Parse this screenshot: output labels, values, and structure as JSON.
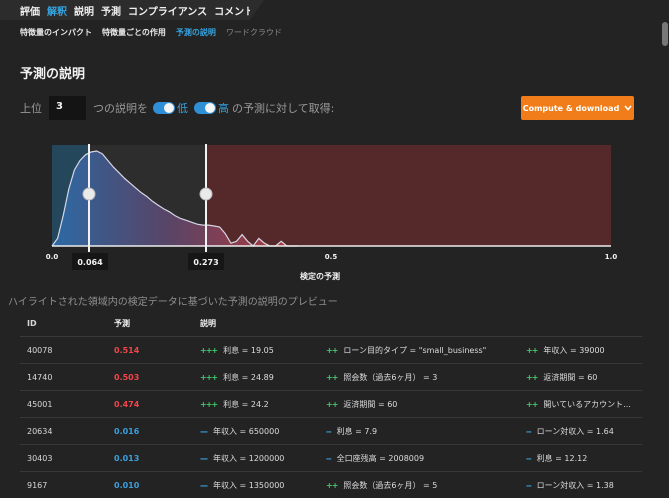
{
  "top_tabs": [
    "評価",
    "解釈",
    "説明",
    "予測",
    "コンプライアンス",
    "コメント"
  ],
  "sub_tabs": [
    "特徴量のインパクト",
    "特徴量ごとの作用",
    "予測の説明",
    "ワードクラウド"
  ],
  "section_title": "予測の説明",
  "controls": {
    "prefix": "上位",
    "count": "3",
    "explanations_label": "つの説明を",
    "low_label": "低",
    "high_label": "高",
    "suffix": "の予測に対して取得:"
  },
  "compute_button": "Compute & download",
  "colors": {
    "accent_orange": "#f07d1a",
    "positive": "#43c96b",
    "negative": "#3a9fdc",
    "high_prediction": "#f0454b"
  },
  "chart_data": {
    "type": "area",
    "xlabel": "検定の予測",
    "xlim": [
      0,
      1
    ],
    "x_ticks": [
      "0.0",
      "0.5",
      "1.0"
    ],
    "x": [
      0.0,
      0.01,
      0.02,
      0.03,
      0.04,
      0.05,
      0.06,
      0.07,
      0.08,
      0.09,
      0.1,
      0.11,
      0.12,
      0.13,
      0.14,
      0.15,
      0.16,
      0.17,
      0.18,
      0.19,
      0.2,
      0.21,
      0.22,
      0.23,
      0.24,
      0.25,
      0.26,
      0.27,
      0.28,
      0.29,
      0.3,
      0.31,
      0.32,
      0.33,
      0.34,
      0.35,
      0.36,
      0.37,
      0.38,
      0.39,
      0.4,
      0.41,
      0.42,
      0.43,
      0.44
    ],
    "density": [
      0.0,
      0.08,
      0.32,
      0.6,
      0.8,
      0.9,
      0.96,
      0.99,
      1.0,
      0.97,
      0.9,
      0.83,
      0.77,
      0.71,
      0.66,
      0.61,
      0.56,
      0.52,
      0.47,
      0.43,
      0.39,
      0.36,
      0.32,
      0.29,
      0.27,
      0.25,
      0.23,
      0.22,
      0.22,
      0.21,
      0.2,
      0.13,
      0.03,
      0.05,
      0.12,
      0.05,
      0.0,
      0.08,
      0.03,
      0.0,
      0.0,
      0.05,
      0.0,
      0.0,
      0.0
    ],
    "low_threshold": "0.064",
    "high_threshold": "0.273"
  },
  "caption": "ハイライトされた領域内の検定データに基づいた予測の説明のプレビュー",
  "table": {
    "headers": {
      "id": "ID",
      "prediction": "予測",
      "explanation": "説明"
    },
    "rows": [
      {
        "id": "40078",
        "pred": "0.514",
        "level": "high",
        "expl": [
          {
            "sym": "+++",
            "text": "利息 = 19.05"
          },
          {
            "sym": "++",
            "text": "ローン目的タイプ = \"small_business\""
          },
          {
            "sym": "++",
            "text": "年収入 = 39000"
          }
        ]
      },
      {
        "id": "14740",
        "pred": "0.503",
        "level": "high",
        "expl": [
          {
            "sym": "+++",
            "text": "利息 = 24.89"
          },
          {
            "sym": "++",
            "text": "照会数（過去6ヶ月） = 3"
          },
          {
            "sym": "++",
            "text": "返済期間 = 60"
          }
        ]
      },
      {
        "id": "45001",
        "pred": "0.474",
        "level": "high",
        "expl": [
          {
            "sym": "+++",
            "text": "利息 = 24.2"
          },
          {
            "sym": "++",
            "text": "返済期間 = 60"
          },
          {
            "sym": "++",
            "text": "開いているアカウント..."
          }
        ]
      },
      {
        "id": "20634",
        "pred": "0.016",
        "level": "low",
        "expl": [
          {
            "sym": "---",
            "text": "年収入 = 650000"
          },
          {
            "sym": "--",
            "text": "利息 = 7.9"
          },
          {
            "sym": "--",
            "text": "ローン対収入 = 1.64"
          }
        ]
      },
      {
        "id": "30403",
        "pred": "0.013",
        "level": "low",
        "expl": [
          {
            "sym": "---",
            "text": "年収入 = 1200000"
          },
          {
            "sym": "--",
            "text": "全口座残高 = 2008009"
          },
          {
            "sym": "--",
            "text": "利息 = 12.12"
          }
        ]
      },
      {
        "id": "9167",
        "pred": "0.010",
        "level": "low",
        "expl": [
          {
            "sym": "---",
            "text": "年収入 = 1350000"
          },
          {
            "sym": "++",
            "text": "照会数（過去6ヶ月） = 5"
          },
          {
            "sym": "--",
            "text": "ローン対収入 = 1.38"
          }
        ]
      }
    ]
  }
}
